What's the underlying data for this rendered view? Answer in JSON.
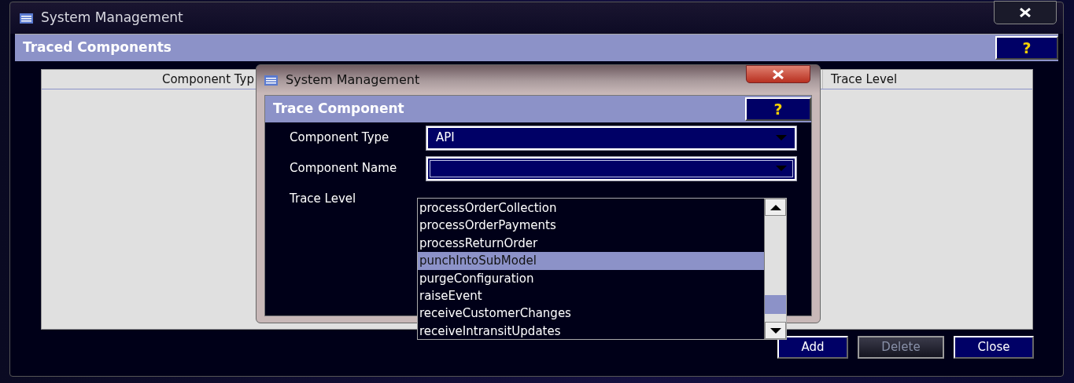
{
  "window": {
    "title": "System Management"
  },
  "panel": {
    "title": "Traced Components",
    "help": "?"
  },
  "table": {
    "columns": [
      {
        "label": "Component Typ"
      },
      {
        "label": "Trace Level"
      }
    ]
  },
  "buttons": [
    {
      "label": "Add",
      "disabled": false
    },
    {
      "label": "Delete",
      "disabled": true
    },
    {
      "label": "Close",
      "disabled": false
    }
  ],
  "dialog": {
    "title": "System Management",
    "header": "Trace Component",
    "help": "?",
    "fields": [
      {
        "kind": "select",
        "label": "Component Type",
        "value": "API",
        "focused": false
      },
      {
        "kind": "select",
        "label": "Component Name",
        "focused": true
      },
      {
        "kind": "label",
        "label": "Trace Level"
      }
    ],
    "dropdown": {
      "items": [
        {
          "label": "processOrderCollection",
          "selected": false
        },
        {
          "label": "processOrderPayments",
          "selected": false
        },
        {
          "label": "processReturnOrder",
          "selected": false
        },
        {
          "label": "punchIntoSubModel",
          "selected": true
        },
        {
          "label": "purgeConfiguration",
          "selected": false
        },
        {
          "label": "raiseEvent",
          "selected": false
        },
        {
          "label": "receiveCustomerChanges",
          "selected": false
        },
        {
          "label": "receiveIntransitUpdates",
          "selected": false
        }
      ]
    }
  }
}
